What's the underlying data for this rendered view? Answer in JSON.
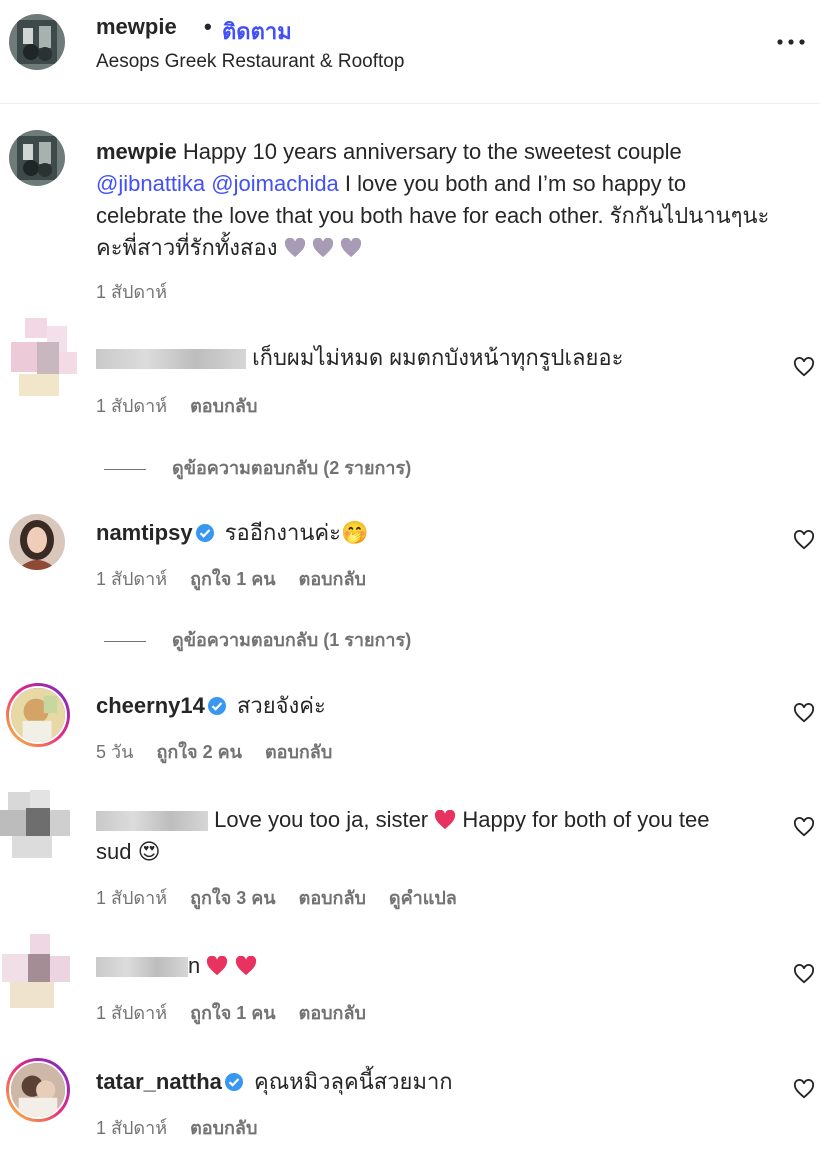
{
  "header": {
    "username": "mewpie",
    "separator": "•",
    "follow_label": "ติดตาม",
    "location": "Aesops Greek Restaurant & Rooftop",
    "more_icon": "more-horizontal-icon"
  },
  "caption": {
    "username": "mewpie",
    "text_part1": "Happy 10 years anniversary to the sweetest couple",
    "mention1": "@jibnattika",
    "mention2": "@joimachida",
    "text_part2": "I love you both and I’m so happy to celebrate the love that you both have for each other. รักกันไปนานๆนะคะพี่สาวที่รักทั้งสอง",
    "time": "1 สัปดาห์"
  },
  "comments": [
    {
      "username": "",
      "text": "เก็บผมไม่หมด ผมตกบังหน้าทุกรูปเลยอะ",
      "time": "1 สัปดาห์",
      "reply_label": "ตอบกลับ",
      "view_replies": "ดูข้อความตอบกลับ (2 รายการ)"
    },
    {
      "username": "namtipsy",
      "verified": true,
      "text": "รออีกงานค่ะ🤭",
      "time": "1 สัปดาห์",
      "likes": "ถูกใจ 1 คน",
      "reply_label": "ตอบกลับ",
      "view_replies": "ดูข้อความตอบกลับ (1 รายการ)"
    },
    {
      "username": "cheerny14",
      "verified": true,
      "text": "สวยจังค่ะ",
      "time": "5 วัน",
      "likes": "ถูกใจ 2 คน",
      "reply_label": "ตอบกลับ"
    },
    {
      "username": "",
      "text_part1": "Love you too ja, sister",
      "text_part2": "Happy for both of you tee",
      "text_part3": "sud 😍",
      "time": "1 สัปดาห์",
      "likes": "ถูกใจ 3 คน",
      "reply_label": "ตอบกลับ",
      "translate_label": "ดูคำแปล"
    },
    {
      "username_fragment": "n",
      "text": "",
      "time": "1 สัปดาห์",
      "likes": "ถูกใจ 1 คน",
      "reply_label": "ตอบกลับ"
    },
    {
      "username": "tatar_nattha",
      "verified": true,
      "text": "คุณหมิวลุคนี้สวยมาก",
      "time": "1 สัปดาห์",
      "reply_label": "ตอบกลับ"
    }
  ],
  "colors": {
    "link": "#4150f7",
    "muted": "#737373",
    "text": "#262626",
    "verified": "#3897f0",
    "heart": "#e8325f"
  }
}
